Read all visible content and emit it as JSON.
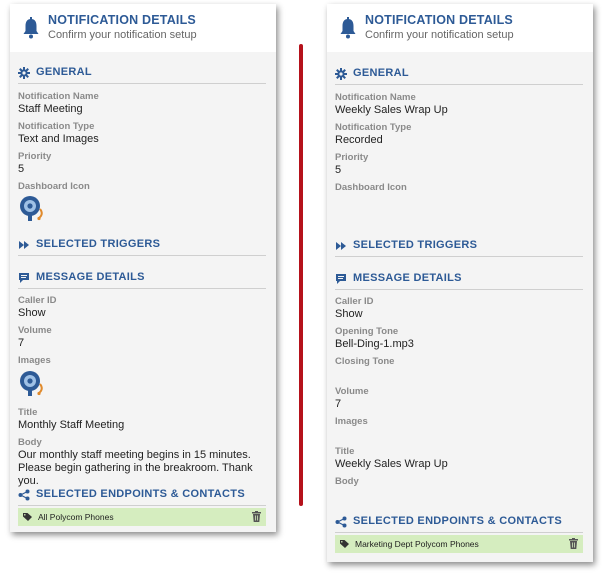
{
  "colors": {
    "accent": "#2d5a96",
    "divider": "#b5121b",
    "endpoint_bg": "#d5edbf"
  },
  "left": {
    "header": {
      "title": "NOTIFICATION DETAILS",
      "subtitle": "Confirm your notification setup",
      "icon": "bell-icon"
    },
    "general": {
      "heading": "GENERAL",
      "icon": "gear-icon"
    },
    "notification_name": {
      "label": "Notification Name",
      "value": "Staff Meeting"
    },
    "notification_type": {
      "label": "Notification Type",
      "value": "Text and Images"
    },
    "priority": {
      "label": "Priority",
      "value": "5"
    },
    "dashboard_icon": {
      "label": "Dashboard Icon",
      "icon": "alarm-bell-icon"
    },
    "triggers": {
      "heading": "SELECTED TRIGGERS",
      "icon": "double-chevron-icon"
    },
    "message": {
      "heading": "MESSAGE DETAILS",
      "icon": "chat-icon"
    },
    "caller_id": {
      "label": "Caller ID",
      "value": "Show"
    },
    "volume": {
      "label": "Volume",
      "value": "7"
    },
    "images": {
      "label": "Images",
      "icon": "alarm-bell-icon"
    },
    "title": {
      "label": "Title",
      "value": "Monthly Staff Meeting"
    },
    "body": {
      "label": "Body",
      "value": "Our monthly staff meeting begins in 15 minutes. Please begin gathering in the breakroom. Thank you."
    },
    "endpoints": {
      "heading": "SELECTED ENDPOINTS & CONTACTS",
      "icon": "share-icon",
      "items": [
        "All Polycom Phones"
      ]
    }
  },
  "right": {
    "header": {
      "title": "NOTIFICATION DETAILS",
      "subtitle": "Confirm your notification setup",
      "icon": "bell-icon"
    },
    "general": {
      "heading": "GENERAL",
      "icon": "gear-icon"
    },
    "notification_name": {
      "label": "Notification Name",
      "value": "Weekly Sales Wrap Up"
    },
    "notification_type": {
      "label": "Notification Type",
      "value": "Recorded"
    },
    "priority": {
      "label": "Priority",
      "value": "5"
    },
    "dashboard_icon": {
      "label": "Dashboard Icon"
    },
    "triggers": {
      "heading": "SELECTED TRIGGERS",
      "icon": "double-chevron-icon"
    },
    "message": {
      "heading": "MESSAGE DETAILS",
      "icon": "chat-icon"
    },
    "caller_id": {
      "label": "Caller ID",
      "value": "Show"
    },
    "opening_tone": {
      "label": "Opening Tone",
      "value": "Bell-Ding-1.mp3"
    },
    "closing_tone": {
      "label": "Closing Tone"
    },
    "volume": {
      "label": "Volume",
      "value": "7"
    },
    "images": {
      "label": "Images"
    },
    "title": {
      "label": "Title",
      "value": "Weekly Sales Wrap Up"
    },
    "body": {
      "label": "Body"
    },
    "endpoints": {
      "heading": "SELECTED ENDPOINTS & CONTACTS",
      "icon": "share-icon",
      "items": [
        "Marketing Dept Polycom Phones"
      ]
    }
  }
}
